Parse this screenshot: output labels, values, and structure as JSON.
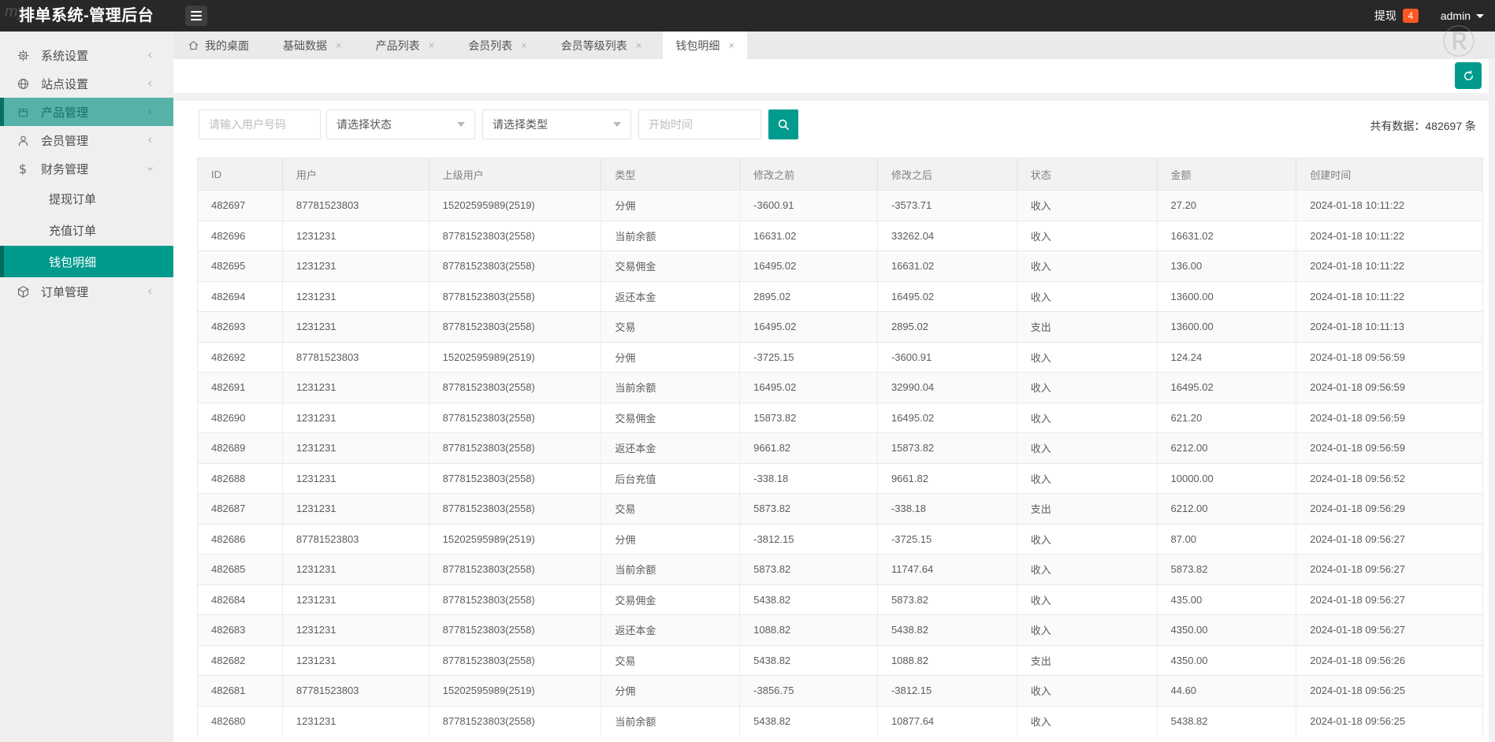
{
  "header": {
    "title": "排单系统-管理后台",
    "withdraw_label": "提现",
    "withdraw_badge": "4",
    "username": "admin"
  },
  "watermarks": {
    "left": "my",
    "right": "Ⓡ"
  },
  "sidebar": {
    "items": [
      {
        "id": "system-settings",
        "label": "系统设置",
        "icon": "gear",
        "chevron": "left",
        "type": "main",
        "state": "normal"
      },
      {
        "id": "site-settings",
        "label": "站点设置",
        "icon": "globe",
        "chevron": "left",
        "type": "main",
        "state": "normal"
      },
      {
        "id": "product-manage",
        "label": "产品管理",
        "icon": "box",
        "chevron": "left",
        "type": "main",
        "state": "highlight"
      },
      {
        "id": "member-manage",
        "label": "会员管理",
        "icon": "user",
        "chevron": "left",
        "type": "main",
        "state": "normal"
      },
      {
        "id": "finance-manage",
        "label": "财务管理",
        "icon": "dollar",
        "chevron": "down",
        "type": "main",
        "state": "expanded"
      },
      {
        "id": "withdraw-orders",
        "label": "提现订单",
        "type": "sub",
        "state": "normal"
      },
      {
        "id": "recharge-orders",
        "label": "充值订单",
        "type": "sub",
        "state": "normal"
      },
      {
        "id": "wallet-detail",
        "label": "钱包明细",
        "type": "sub",
        "state": "active"
      },
      {
        "id": "order-manage",
        "label": "订单管理",
        "icon": "cube",
        "chevron": "left",
        "type": "main",
        "state": "normal"
      }
    ]
  },
  "tabs": [
    {
      "id": "desktop",
      "label": "我的桌面",
      "icon": "home",
      "closable": false,
      "active": false
    },
    {
      "id": "base-data",
      "label": "基础数据",
      "closable": true,
      "active": false
    },
    {
      "id": "product-list",
      "label": "产品列表",
      "closable": true,
      "active": false
    },
    {
      "id": "member-list",
      "label": "会员列表",
      "closable": true,
      "active": false
    },
    {
      "id": "member-level-list",
      "label": "会员等级列表",
      "closable": true,
      "active": false
    },
    {
      "id": "wallet-detail",
      "label": "钱包明细",
      "closable": true,
      "active": true
    }
  ],
  "filters": {
    "user_placeholder": "请输入用户号码",
    "status_placeholder": "请选择状态",
    "type_placeholder": "请选择类型",
    "date_placeholder": "开始时间"
  },
  "summary": {
    "text": "共有数据：482697 条"
  },
  "table": {
    "columns": [
      "ID",
      "用户",
      "上级用户",
      "类型",
      "修改之前",
      "修改之后",
      "状态",
      "金额",
      "创建时间"
    ],
    "rows": [
      [
        "482697",
        "87781523803",
        "15202595989(2519)",
        "分佣",
        "-3600.91",
        "-3573.71",
        "收入",
        "27.20",
        "2024-01-18 10:11:22"
      ],
      [
        "482696",
        "1231231",
        "87781523803(2558)",
        "当前余额",
        "16631.02",
        "33262.04",
        "收入",
        "16631.02",
        "2024-01-18 10:11:22"
      ],
      [
        "482695",
        "1231231",
        "87781523803(2558)",
        "交易佣金",
        "16495.02",
        "16631.02",
        "收入",
        "136.00",
        "2024-01-18 10:11:22"
      ],
      [
        "482694",
        "1231231",
        "87781523803(2558)",
        "返还本金",
        "2895.02",
        "16495.02",
        "收入",
        "13600.00",
        "2024-01-18 10:11:22"
      ],
      [
        "482693",
        "1231231",
        "87781523803(2558)",
        "交易",
        "16495.02",
        "2895.02",
        "支出",
        "13600.00",
        "2024-01-18 10:11:13"
      ],
      [
        "482692",
        "87781523803",
        "15202595989(2519)",
        "分佣",
        "-3725.15",
        "-3600.91",
        "收入",
        "124.24",
        "2024-01-18 09:56:59"
      ],
      [
        "482691",
        "1231231",
        "87781523803(2558)",
        "当前余额",
        "16495.02",
        "32990.04",
        "收入",
        "16495.02",
        "2024-01-18 09:56:59"
      ],
      [
        "482690",
        "1231231",
        "87781523803(2558)",
        "交易佣金",
        "15873.82",
        "16495.02",
        "收入",
        "621.20",
        "2024-01-18 09:56:59"
      ],
      [
        "482689",
        "1231231",
        "87781523803(2558)",
        "返还本金",
        "9661.82",
        "15873.82",
        "收入",
        "6212.00",
        "2024-01-18 09:56:59"
      ],
      [
        "482688",
        "1231231",
        "87781523803(2558)",
        "后台充值",
        "-338.18",
        "9661.82",
        "收入",
        "10000.00",
        "2024-01-18 09:56:52"
      ],
      [
        "482687",
        "1231231",
        "87781523803(2558)",
        "交易",
        "5873.82",
        "-338.18",
        "支出",
        "6212.00",
        "2024-01-18 09:56:29"
      ],
      [
        "482686",
        "87781523803",
        "15202595989(2519)",
        "分佣",
        "-3812.15",
        "-3725.15",
        "收入",
        "87.00",
        "2024-01-18 09:56:27"
      ],
      [
        "482685",
        "1231231",
        "87781523803(2558)",
        "当前余额",
        "5873.82",
        "11747.64",
        "收入",
        "5873.82",
        "2024-01-18 09:56:27"
      ],
      [
        "482684",
        "1231231",
        "87781523803(2558)",
        "交易佣金",
        "5438.82",
        "5873.82",
        "收入",
        "435.00",
        "2024-01-18 09:56:27"
      ],
      [
        "482683",
        "1231231",
        "87781523803(2558)",
        "返还本金",
        "1088.82",
        "5438.82",
        "收入",
        "4350.00",
        "2024-01-18 09:56:27"
      ],
      [
        "482682",
        "1231231",
        "87781523803(2558)",
        "交易",
        "5438.82",
        "1088.82",
        "支出",
        "4350.00",
        "2024-01-18 09:56:26"
      ],
      [
        "482681",
        "87781523803",
        "15202595989(2519)",
        "分佣",
        "-3856.75",
        "-3812.15",
        "收入",
        "44.60",
        "2024-01-18 09:56:25"
      ],
      [
        "482680",
        "1231231",
        "87781523803(2558)",
        "当前余额",
        "5438.82",
        "10877.64",
        "收入",
        "5438.82",
        "2024-01-18 09:56:25"
      ]
    ]
  },
  "colors": {
    "accent_teal": "#009b8d",
    "active_stripe": "#00695e",
    "header_bg": "#282828",
    "badge_orange": "#ff5722",
    "sidebar_bg": "#efefef"
  }
}
